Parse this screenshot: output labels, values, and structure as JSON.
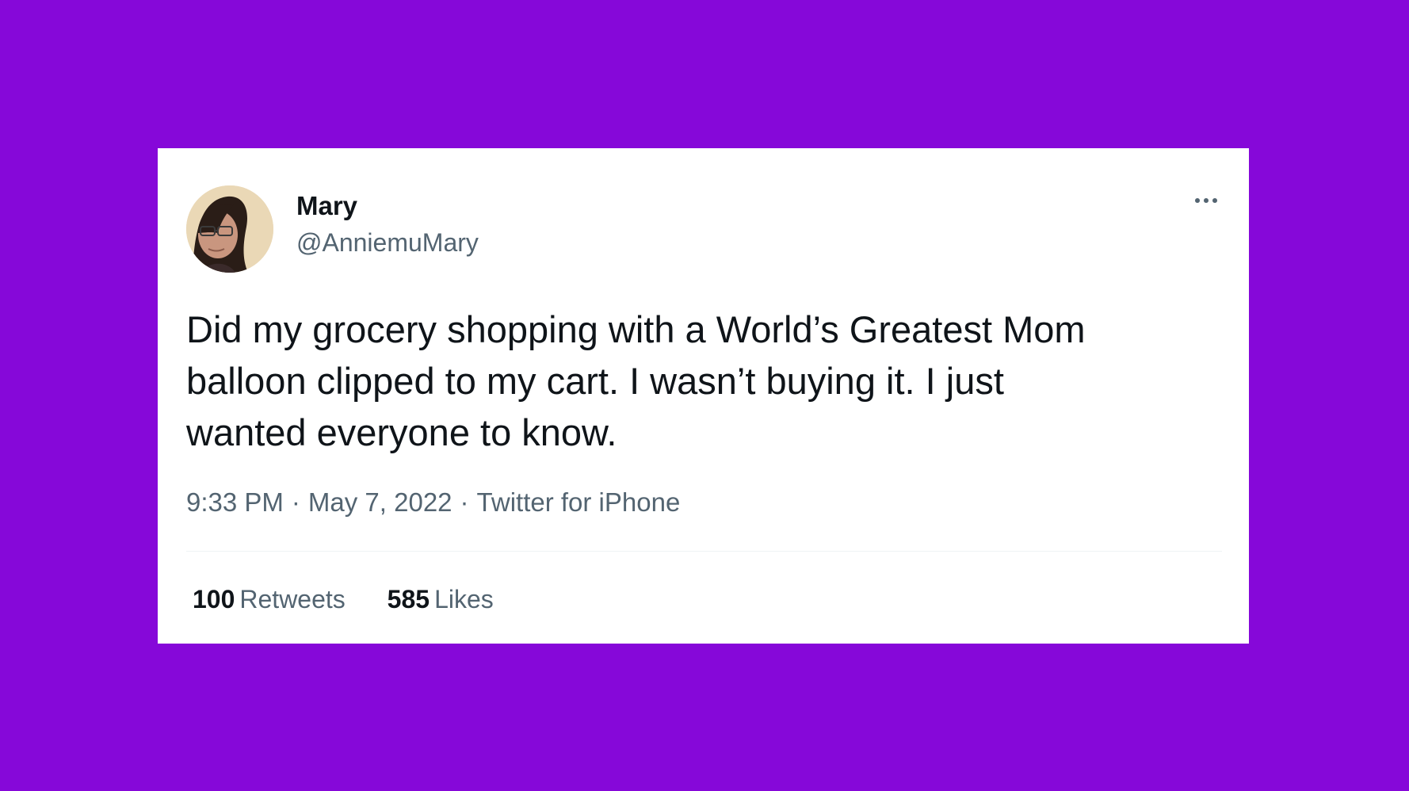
{
  "theme": {
    "background": "#8608d9",
    "card_background": "#ffffff",
    "primary_text": "#0f1419",
    "secondary_text": "#536471"
  },
  "tweet": {
    "author": {
      "display_name": "Mary",
      "handle": "@AnniemuMary",
      "avatar_icon": "profile-photo"
    },
    "more_icon": "ellipsis-icon",
    "text": "Did my grocery shopping with a World’s Greatest Mom\nballoon clipped to my cart. I wasn’t buying it. I just\nwanted everyone to know.",
    "time": "9:33 PM",
    "date": "May 7, 2022",
    "source": "Twitter for iPhone",
    "separator": "·",
    "stats": {
      "retweets_count": "100",
      "retweets_label": "Retweets",
      "likes_count": "585",
      "likes_label": "Likes"
    }
  }
}
